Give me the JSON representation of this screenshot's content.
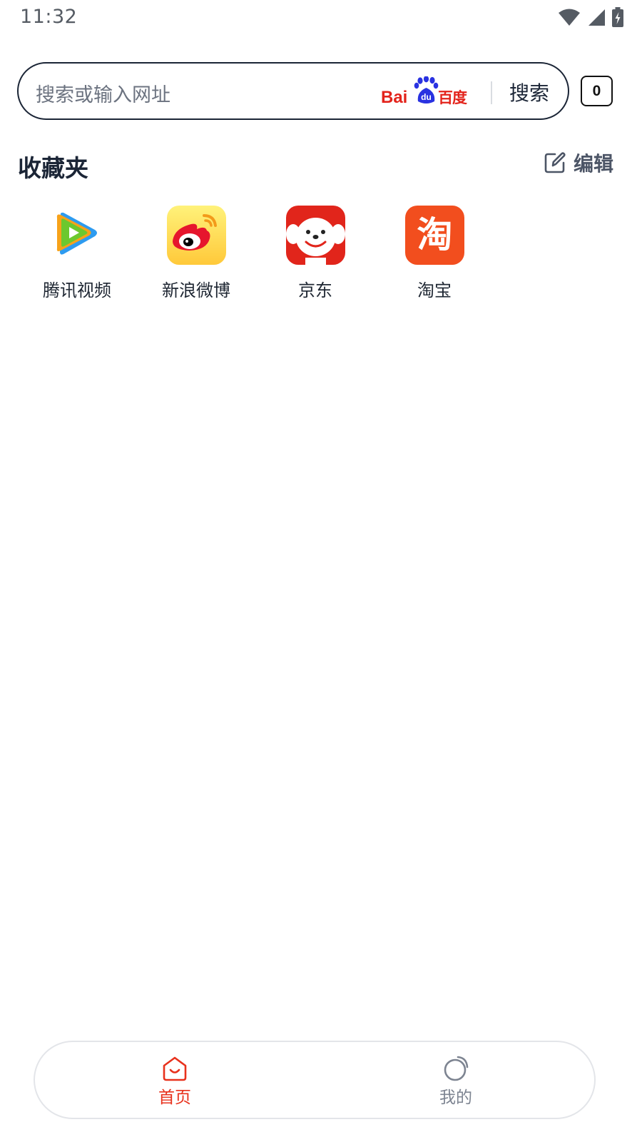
{
  "status_bar": {
    "time": "11:32",
    "icons": [
      "wifi-icon",
      "cell-signal-icon",
      "battery-charging-icon"
    ]
  },
  "search": {
    "placeholder": "搜索或输入网址",
    "engine_logo": "Baidu百度",
    "button_label": "搜索"
  },
  "tab_counter": "0",
  "favorites": {
    "title": "收藏夹",
    "edit_label": "编辑",
    "items": [
      {
        "label": "腾讯视频",
        "icon": "tencent-video-icon"
      },
      {
        "label": "新浪微博",
        "icon": "weibo-icon"
      },
      {
        "label": "京东",
        "icon": "jd-icon"
      },
      {
        "label": "淘宝",
        "icon": "taobao-icon"
      }
    ]
  },
  "bottom_nav": {
    "items": [
      {
        "label": "首页",
        "icon": "home-icon",
        "active": true
      },
      {
        "label": "我的",
        "icon": "profile-icon",
        "active": false
      }
    ]
  },
  "colors": {
    "accent": "#e8311c",
    "text_dark": "#1b2536",
    "text_muted": "#6c7380",
    "baidu_red": "#e3231b",
    "baidu_blue": "#2932e1"
  }
}
